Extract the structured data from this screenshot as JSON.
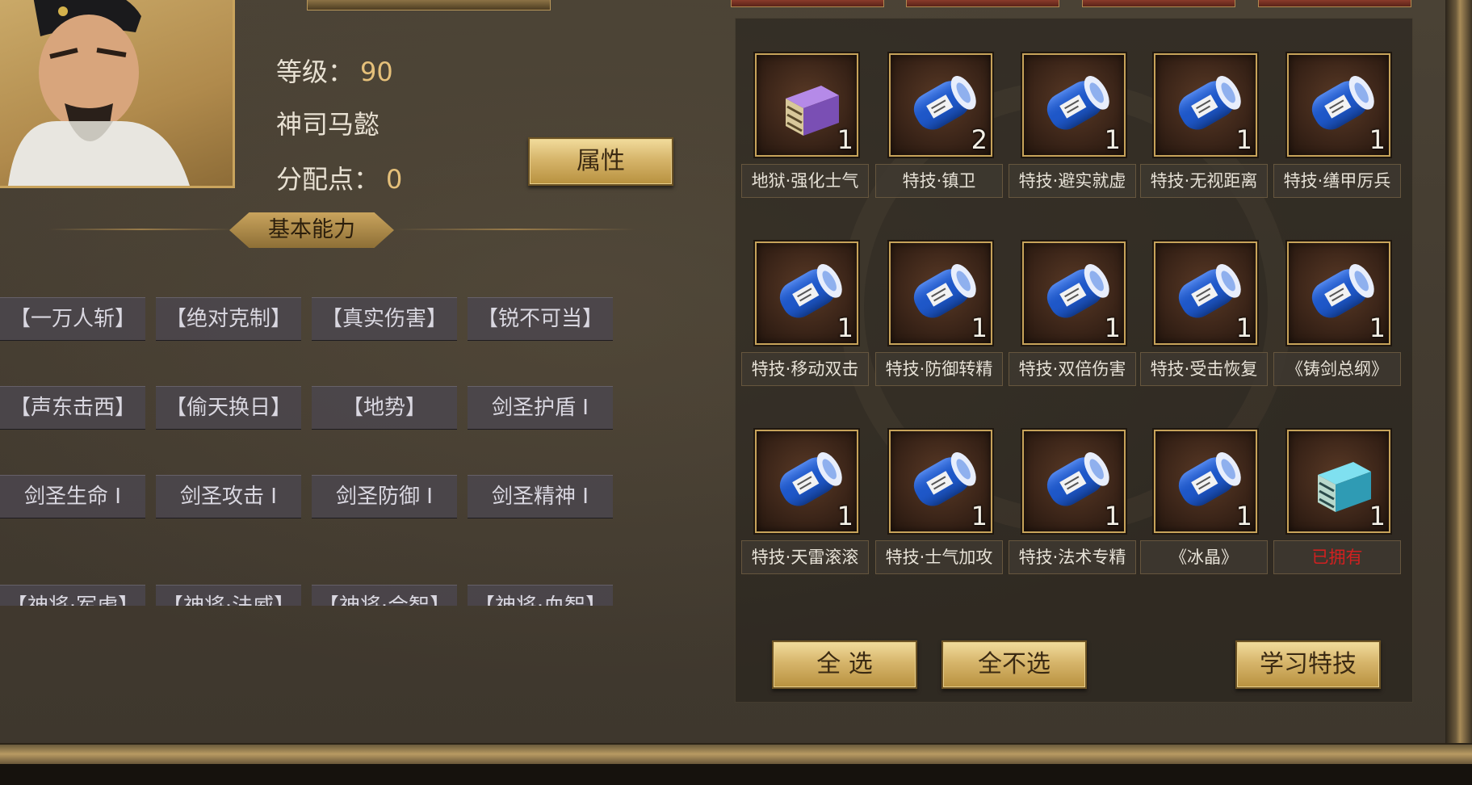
{
  "hero": {
    "level_label": "等级：",
    "level_value": "90",
    "name": "神司马懿",
    "points_label": "分配点：",
    "points_value": "0",
    "attr_button": "属性"
  },
  "section_title": "基本能力",
  "skills": [
    [
      "【一万人斩】",
      "【绝对克制】",
      "【真实伤害】",
      "【锐不可当】"
    ],
    [
      "【声东击西】",
      "【偷天换日】",
      "【地势】",
      "剑圣护盾 I"
    ],
    [
      "剑圣生命 I",
      "剑圣攻击 I",
      "剑圣防御 I",
      "剑圣精神 I"
    ],
    [
      "【神将·军虎】",
      "【神将·法威】",
      "【神将·会智】",
      "【神将·血智】"
    ]
  ],
  "items": [
    {
      "label": "地狱·强化士气",
      "count": "1",
      "icon": "purple-book-icon"
    },
    {
      "label": "特技·镇卫",
      "count": "2",
      "icon": "blue-scroll-icon"
    },
    {
      "label": "特技·避实就虚",
      "count": "1",
      "icon": "blue-scroll-icon"
    },
    {
      "label": "特技·无视距离",
      "count": "1",
      "icon": "blue-scroll-icon"
    },
    {
      "label": "特技·缮甲厉兵",
      "count": "1",
      "icon": "blue-scroll-icon"
    },
    {
      "label": "特技·移动双击",
      "count": "1",
      "icon": "blue-scroll-icon"
    },
    {
      "label": "特技·防御转精",
      "count": "1",
      "icon": "blue-scroll-icon"
    },
    {
      "label": "特技·双倍伤害",
      "count": "1",
      "icon": "blue-scroll-icon"
    },
    {
      "label": "特技·受击恢复",
      "count": "1",
      "icon": "blue-scroll-icon"
    },
    {
      "label": "《铸剑总纲》",
      "count": "1",
      "icon": "blue-scroll-icon"
    },
    {
      "label": "特技·天雷滚滚",
      "count": "1",
      "icon": "blue-scroll-icon"
    },
    {
      "label": "特技·士气加攻",
      "count": "1",
      "icon": "blue-scroll-icon"
    },
    {
      "label": "特技·法术专精",
      "count": "1",
      "icon": "blue-scroll-icon"
    },
    {
      "label": "《冰晶》",
      "count": "1",
      "icon": "blue-scroll-icon"
    },
    {
      "label": "已拥有",
      "count": "1",
      "icon": "cyan-book-icon",
      "owned": true
    }
  ],
  "buttons": {
    "select_all": "全 选",
    "deselect_all": "全不选",
    "learn": "学习特技"
  },
  "colors": {
    "gold": "#d6b56b",
    "owned_red": "#d12020",
    "level_value": "#e5c07a"
  }
}
